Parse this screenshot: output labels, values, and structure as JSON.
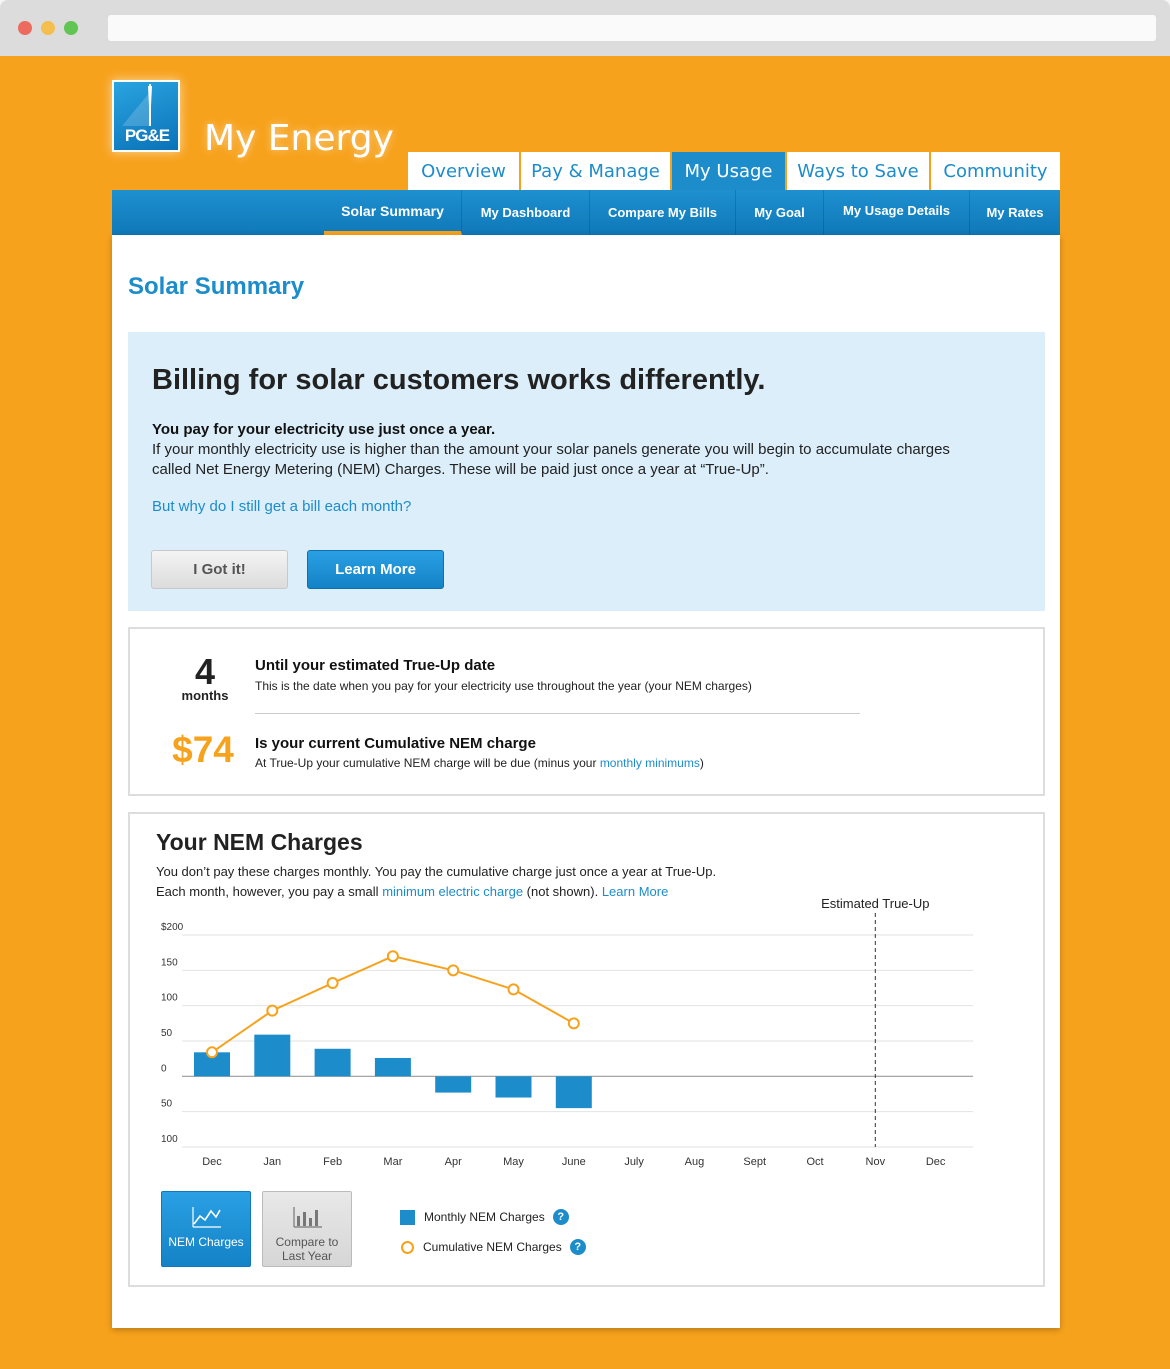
{
  "header": {
    "logo_text": "PG&E",
    "app_title": "My Energy"
  },
  "main_tabs": [
    {
      "label": "Overview"
    },
    {
      "label": "Pay & Manage"
    },
    {
      "label": "My Usage",
      "active": true
    },
    {
      "label": "Ways to Save"
    },
    {
      "label": "Community"
    }
  ],
  "sub_nav": [
    {
      "label": "Solar Summary",
      "active": true
    },
    {
      "label": "My Dashboard"
    },
    {
      "label": "Compare My Bills"
    },
    {
      "label": "My Goal"
    },
    {
      "label": "My Usage Details"
    },
    {
      "label": "My Rates"
    }
  ],
  "page_title": "Solar Summary",
  "info": {
    "heading": "Billing for solar customers works differently.",
    "subheading": "You pay for your electricity use just once a year.",
    "body": "If your monthly electricity use is higher than the amount your solar panels generate you will begin to accumulate charges called Net Energy Metering (NEM) Charges. These will be paid just once a year at “True-Up”.",
    "link": "But why do I still get a bill each month?",
    "btn_got": "I Got it!",
    "btn_learn": "Learn More"
  },
  "stats": {
    "months_value": "4",
    "months_label": "months",
    "trueup_title": "Until your estimated True-Up date",
    "trueup_desc": "This is the date when you pay for your electricity use throughout the year (your NEM charges)",
    "nem_amount": "$74",
    "nem_title": "Is your current Cumulative NEM charge",
    "nem_desc_pre": "At True-Up your cumulative NEM charge will be due (minus your ",
    "nem_desc_link": "monthly minimums",
    "nem_desc_post": ")"
  },
  "nem_section": {
    "title": "Your NEM Charges",
    "desc_line1": "You don’t pay these charges monthly. You pay the cumulative charge just once a year at True-Up.",
    "desc_line2_pre": "Each month, however, you pay a small ",
    "desc_line2_link": "minimum electric charge",
    "desc_line2_mid": " (not shown). ",
    "desc_line2_link2": "Learn More",
    "trueup_marker": "Estimated True-Up",
    "view_nem_label": "NEM Charges",
    "view_compare_label_1": "Compare to",
    "view_compare_label_2": "Last Year",
    "legend_monthly": "Monthly NEM Charges",
    "legend_cumulative": "Cumulative NEM Charges",
    "help_glyph": "?"
  },
  "chart_data": {
    "type": "bar",
    "categories": [
      "Dec",
      "Jan",
      "Feb",
      "Mar",
      "Apr",
      "May",
      "June",
      "July",
      "Aug",
      "Sept",
      "Oct",
      "Nov",
      "Dec"
    ],
    "series": [
      {
        "name": "Monthly NEM Charges",
        "type": "bar",
        "values": [
          34,
          59,
          39,
          26,
          -23,
          -30,
          -45,
          null,
          null,
          null,
          null,
          null,
          null
        ],
        "color": "#1d8ccb"
      },
      {
        "name": "Cumulative NEM Charges",
        "type": "line",
        "values": [
          34,
          93,
          132,
          170,
          150,
          123,
          75,
          null,
          null,
          null,
          null,
          null,
          null
        ],
        "color": "#f7a21c"
      }
    ],
    "y_ticks": [
      "$200",
      "150",
      "100",
      "50",
      "0",
      "50",
      "100"
    ],
    "y_tick_values": [
      200,
      150,
      100,
      50,
      0,
      -50,
      -100
    ],
    "ylim": [
      -100,
      200
    ],
    "trueup_category": "Nov",
    "grid": true
  }
}
